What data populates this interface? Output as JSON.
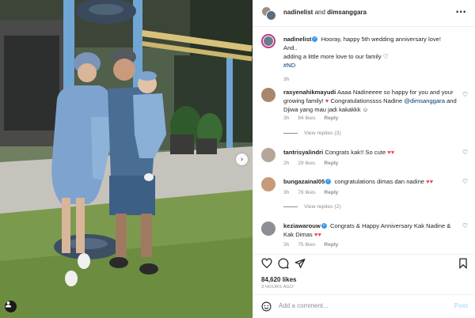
{
  "header": {
    "user1": "nadinelist",
    "and": "and",
    "user2": "dimsanggara"
  },
  "caption": {
    "username": "nadinelist",
    "line1": "Hooray, happy 5th wedding anniversary love!",
    "line2": "And..",
    "line3": "adding a little more love to our family",
    "hashtag": "#ND",
    "time": "3h"
  },
  "comments": [
    {
      "username": "rasyenahikmayudi",
      "text_a": "Aaaa Nadineeee so happy for you and your growing family!",
      "text_b": "Congratulationssss Nadine",
      "mention": "@dimsanggara",
      "text_c": "and Djiwa yang mau jadi kakakkk",
      "time": "3h",
      "likes": "84 likes",
      "reply": "Reply",
      "view_replies": "View replies (3)"
    },
    {
      "username": "tantrisyalindri",
      "text_a": "Congrats kak!! So cute",
      "time": "2h",
      "likes": "29 likes",
      "reply": "Reply"
    },
    {
      "username": "bungazainal05",
      "text_a": "congratulations dimas dan nadine",
      "time": "3h",
      "likes": "78 likes",
      "reply": "Reply",
      "view_replies": "View replies (2)"
    },
    {
      "username": "keziawarouw",
      "text_a": "Congrats & Happy Anniversary Kak Nadine & Kak Dimas",
      "time": "3h",
      "likes": "75 likes",
      "reply": "Reply"
    }
  ],
  "actions": {
    "likes": "84,620 likes",
    "posted_ago": "3 HOURS AGO"
  },
  "comment_box": {
    "placeholder": "Add a comment...",
    "post": "Post"
  },
  "icons": {
    "more": "more-options-icon",
    "like": "heart-icon",
    "comment": "comment-icon",
    "share": "share-icon",
    "save": "bookmark-icon",
    "emoji": "emoji-icon",
    "next": "chevron-right-icon",
    "tag": "user-tag-icon"
  },
  "colors": {
    "link": "#00376b",
    "verified": "#3897f0",
    "red_heart": "#ed4956",
    "post_disabled": "#b2dffc"
  }
}
